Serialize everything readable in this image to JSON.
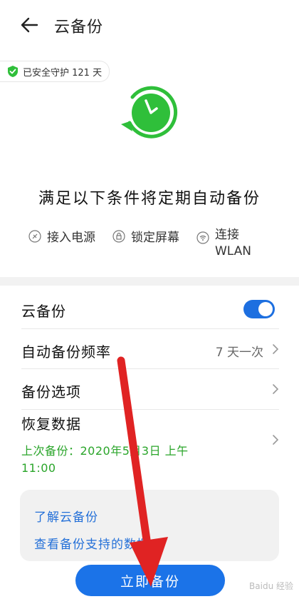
{
  "header": {
    "title": "云备份"
  },
  "badge": {
    "text": "已安全守护 121 天"
  },
  "conditions": {
    "title": "满足以下条件将定期自动备份",
    "items": [
      {
        "label": "接入电源"
      },
      {
        "label": "锁定屏幕"
      },
      {
        "label_line1": "连接",
        "label_line2": "WLAN"
      }
    ]
  },
  "settings": {
    "cloud_backup": {
      "label": "云备份",
      "enabled": true
    },
    "frequency": {
      "label": "自动备份频率",
      "value": "7 天一次"
    },
    "options": {
      "label": "备份选项"
    },
    "restore": {
      "label": "恢复数据",
      "last_backup_line1": "上次备份：2020年5月3日  上午",
      "last_backup_line2": "11:00"
    }
  },
  "links": [
    {
      "label": "了解云备份"
    },
    {
      "label": "查看备份支持的数据"
    }
  ],
  "primary_action": {
    "label": "立即备份"
  },
  "watermark": "Baidu 经验",
  "colors": {
    "accent": "#1b73e8",
    "success": "#2aa52a",
    "clock_green": "#2fbf3a",
    "arrow": "#e02323"
  }
}
